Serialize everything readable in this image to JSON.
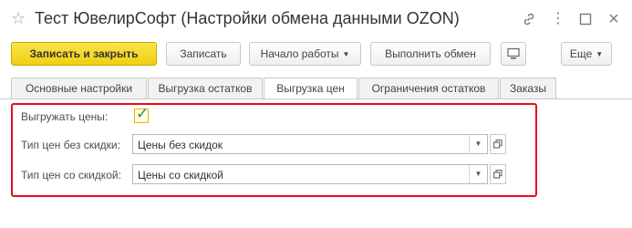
{
  "window": {
    "title": "Тест ЮвелирСофт (Настройки обмена данными OZON)",
    "star_icon": "☆",
    "link_icon": "link-icon",
    "more_icon": "⋮",
    "maximize_icon": "□",
    "close_icon": "×"
  },
  "toolbar": {
    "save_close": "Записать и закрыть",
    "save": "Записать",
    "start": "Начало работы",
    "run_exchange": "Выполнить обмен",
    "more": "Еще"
  },
  "tabs": [
    {
      "label": "Основные настройки"
    },
    {
      "label": "Выгрузка остатков"
    },
    {
      "label": "Выгрузка цен"
    },
    {
      "label": "Ограничения остатков"
    },
    {
      "label": "Заказы"
    }
  ],
  "form": {
    "export_prices_label": "Выгружать цены:",
    "export_prices_checked": true,
    "price_no_discount_label": "Тип цен без скидки:",
    "price_no_discount_value": "Цены без скидок",
    "price_discount_label": "Тип цен со скидкой:",
    "price_discount_value": "Цены со скидкой"
  },
  "colors": {
    "primary_button": "#f5d51f",
    "highlight_border": "#e30e1a",
    "check_color": "#1e9e3a"
  }
}
